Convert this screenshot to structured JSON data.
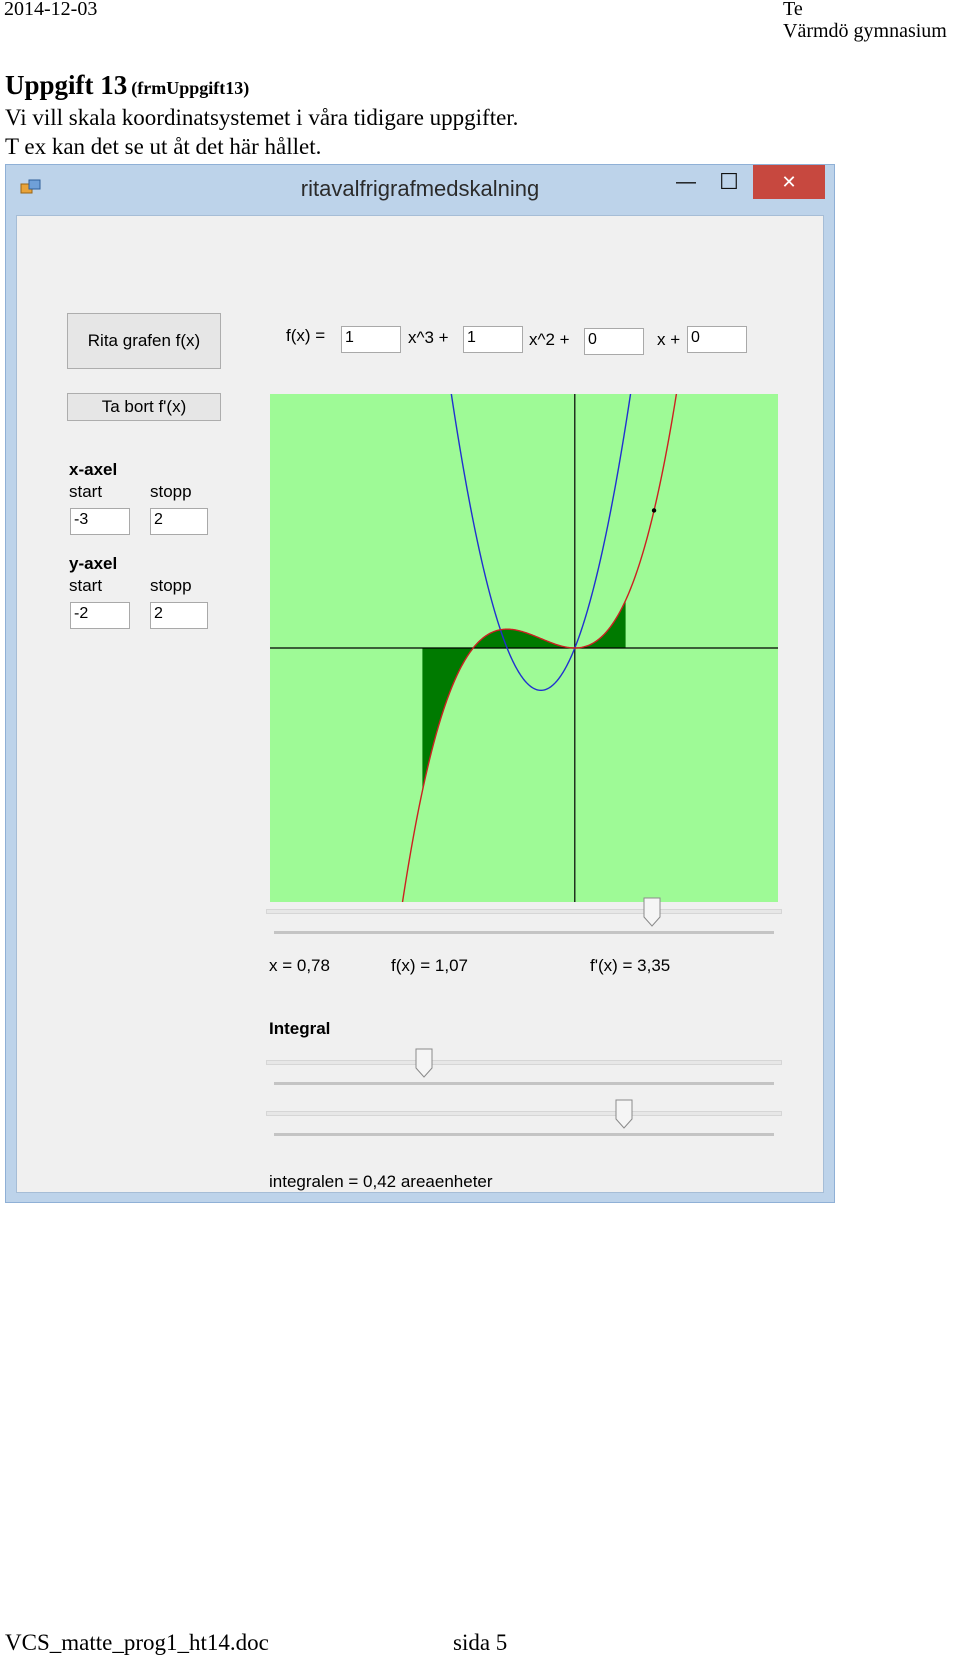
{
  "header": {
    "date": "2014-12-03",
    "author": "Te",
    "school": "Värmdö gymnasium"
  },
  "doc": {
    "title": "Uppgift 13",
    "form_name": "(frmUppgift13)",
    "line1": "Vi vill skala koordinatsystemet i våra tidigare uppgifter.",
    "line2": "T ex kan det se ut åt det här hållet."
  },
  "window": {
    "title": "ritavalfrigrafmedskalning",
    "minimize": "—",
    "maximize": "☐",
    "close": "✕"
  },
  "form": {
    "draw_button": "Rita grafen f(x)",
    "remove_button": "Ta bort f'(x)",
    "fx_label": "f(x) =",
    "coef": [
      "1",
      "1",
      "0",
      "0"
    ],
    "term_labels": [
      "x^3 +",
      "x^2 +",
      "x +"
    ],
    "x_axis": {
      "heading": "x-axel",
      "start_label": "start",
      "stop_label": "stopp",
      "start": "-3",
      "stop": "2"
    },
    "y_axis": {
      "heading": "y-axel",
      "start_label": "start",
      "stop_label": "stopp",
      "start": "-2",
      "stop": "2"
    },
    "readout": {
      "x": "x = 0,78",
      "fx": "f(x) = 1,07",
      "dfx": "f'(x) = 3,35"
    },
    "integral_heading": "Integral",
    "integral_result": "integralen = 0,42 areaenheter",
    "slider_point_x": 0.78,
    "slider_integral_from": -2,
    "slider_integral_to": 1
  },
  "colors": {
    "plot_bg": "#9efa96",
    "area_fill": "#007a00",
    "f_curve": "#cc2020",
    "df_curve": "#2030d0",
    "axes": "#000000"
  },
  "chart_data": {
    "type": "line",
    "xlim": [
      -3,
      2
    ],
    "ylim": [
      -2,
      2
    ],
    "series": [
      {
        "name": "f(x)",
        "function": "x^3 + x^2",
        "coefficients": [
          1,
          1,
          0,
          0
        ]
      },
      {
        "name": "f'(x)",
        "function": "3x^2 + 2x",
        "coefficients": [
          3,
          2,
          0
        ]
      }
    ],
    "point": {
      "x": 0.78,
      "fx": 1.07,
      "dfx": 3.35
    },
    "integral": {
      "from": -1.5,
      "to": 0.5,
      "value": 0.42
    },
    "grid": false
  },
  "footer": {
    "filename": "VCS_matte_prog1_ht14.doc",
    "page": "sida 5"
  }
}
